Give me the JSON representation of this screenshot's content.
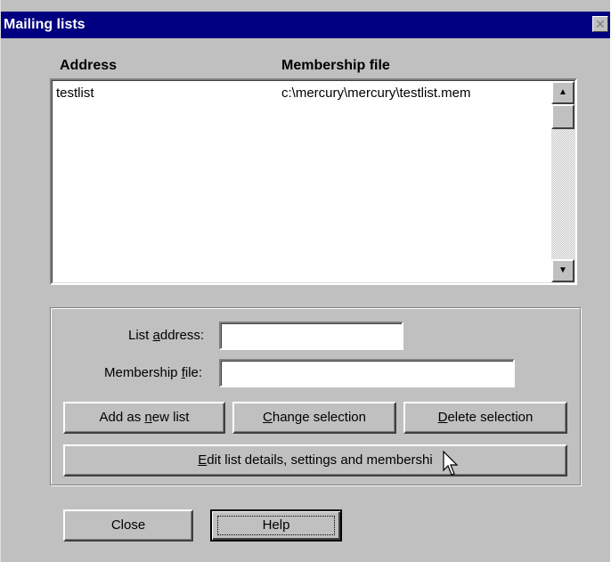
{
  "window": {
    "title": "Mailing lists",
    "close_glyph": "✕"
  },
  "list": {
    "columns": [
      "Address",
      "Membership file"
    ],
    "rows": [
      {
        "address": "testlist",
        "membership_file": "c:\\mercury\\mercury\\testlist.mem"
      }
    ],
    "scroll_up_glyph": "▲",
    "scroll_down_glyph": "▼"
  },
  "form": {
    "list_address_label": {
      "pre": "List ",
      "accel": "a",
      "post": "ddress:"
    },
    "list_address_value": "",
    "membership_file_label": {
      "pre": "Membership ",
      "accel": "f",
      "post": "ile:"
    },
    "membership_file_value": ""
  },
  "buttons": {
    "add_new": {
      "pre": "Add as ",
      "accel": "n",
      "post": "ew list"
    },
    "change": {
      "pre": "",
      "accel": "C",
      "post": "hange selection"
    },
    "delete": {
      "pre": "",
      "accel": "D",
      "post": "elete selection"
    },
    "edit": {
      "pre": "",
      "accel": "E",
      "post": "dit list details, settings and membershi"
    },
    "close": "Close",
    "help": "Help"
  },
  "icons": {
    "close": "close-icon",
    "scroll_up": "arrow-up-icon",
    "scroll_down": "arrow-down-icon",
    "cursor": "mouse-pointer-icon"
  }
}
